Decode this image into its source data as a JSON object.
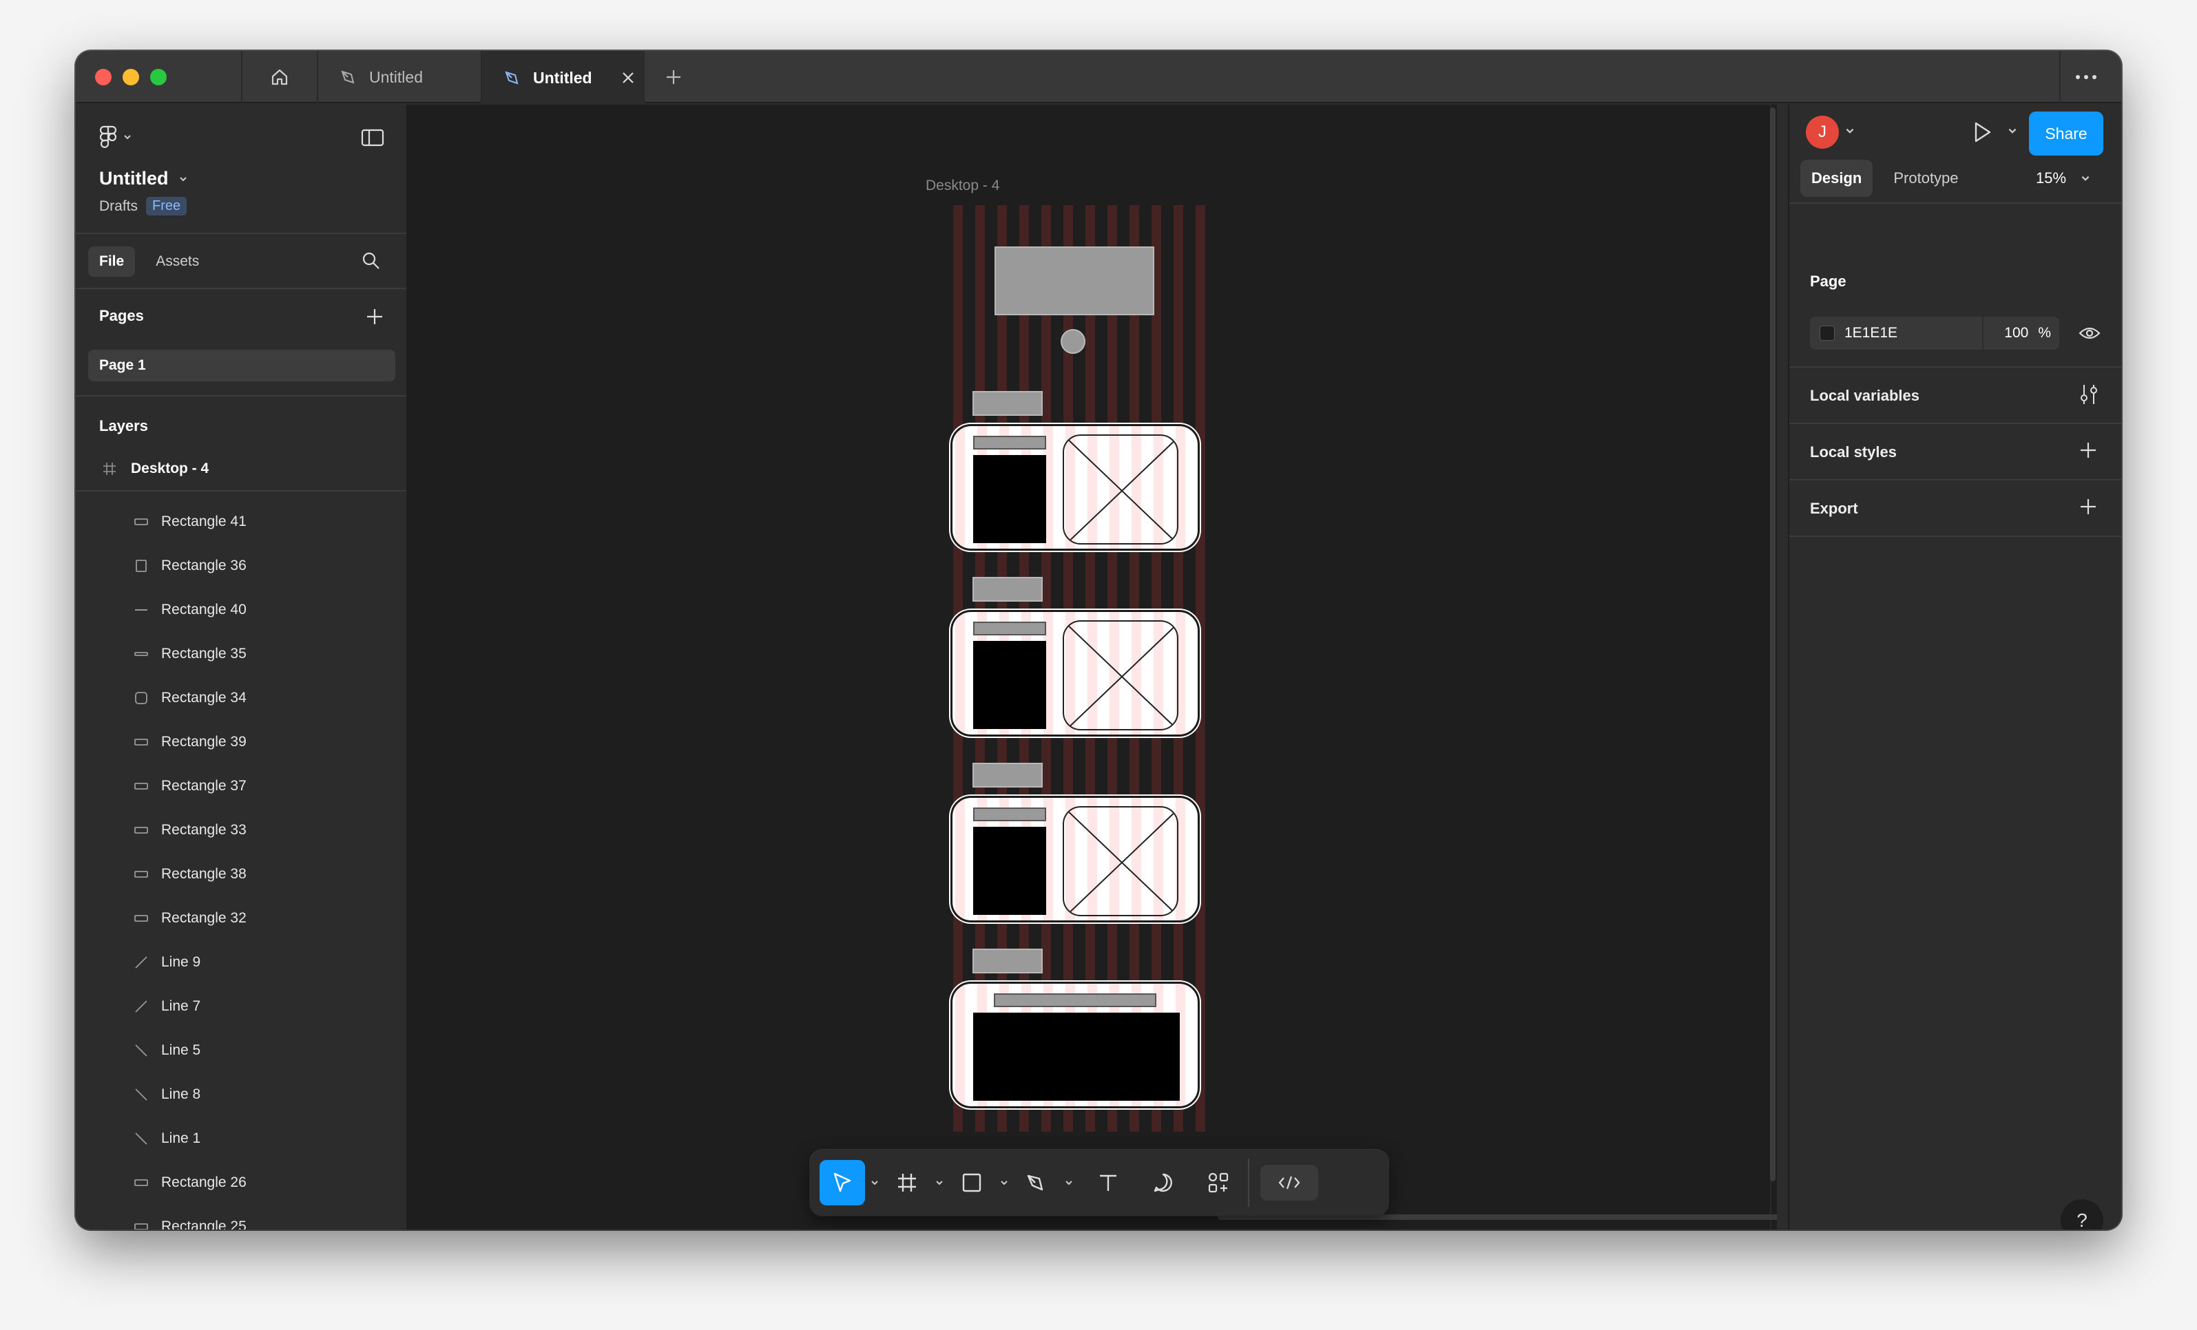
{
  "titlebar": {
    "tabs": [
      {
        "label": "Untitled"
      },
      {
        "label": "Untitled"
      }
    ]
  },
  "file": {
    "name": "Untitled",
    "location": "Drafts",
    "plan": "Free"
  },
  "left_tabs": {
    "file": "File",
    "assets": "Assets"
  },
  "pages": {
    "title": "Pages",
    "items": [
      {
        "label": "Page 1"
      }
    ]
  },
  "layers": {
    "title": "Layers",
    "frame": "Desktop - 4",
    "items": [
      {
        "label": "Rectangle 41",
        "icon": "rect-wide"
      },
      {
        "label": "Rectangle 36",
        "icon": "rect-tall"
      },
      {
        "label": "Rectangle 40",
        "icon": "line-horizontal"
      },
      {
        "label": "Rectangle 35",
        "icon": "rect-thin"
      },
      {
        "label": "Rectangle 34",
        "icon": "rect-rounded"
      },
      {
        "label": "Rectangle 39",
        "icon": "rect-wide"
      },
      {
        "label": "Rectangle 37",
        "icon": "rect-wide"
      },
      {
        "label": "Rectangle 33",
        "icon": "rect-wide"
      },
      {
        "label": "Rectangle 38",
        "icon": "rect-wide"
      },
      {
        "label": "Rectangle 32",
        "icon": "rect-wide"
      },
      {
        "label": "Line 9",
        "icon": "line-up"
      },
      {
        "label": "Line 7",
        "icon": "line-up"
      },
      {
        "label": "Line 5",
        "icon": "line-down"
      },
      {
        "label": "Line 8",
        "icon": "line-down"
      },
      {
        "label": "Line 1",
        "icon": "line-down"
      },
      {
        "label": "Rectangle 26",
        "icon": "rect-wide"
      },
      {
        "label": "Rectangle 25",
        "icon": "rect-wide"
      }
    ]
  },
  "canvas": {
    "frame_label": "Desktop - 4",
    "background": "#1e1e1e"
  },
  "right": {
    "avatar_initial": "J",
    "share": "Share",
    "tabs": {
      "design": "Design",
      "prototype": "Prototype"
    },
    "zoom": "15%",
    "page_section": "Page",
    "page_color": "1E1E1E",
    "page_opacity": "100",
    "percent": "%",
    "sections": {
      "variables": "Local variables",
      "styles": "Local styles",
      "export": "Export"
    },
    "help": "?"
  },
  "colors": {
    "accent": "#0d99ff",
    "avatar": "#e5483a",
    "badge_bg": "#3a4b63",
    "badge_text": "#8cb8ff"
  }
}
